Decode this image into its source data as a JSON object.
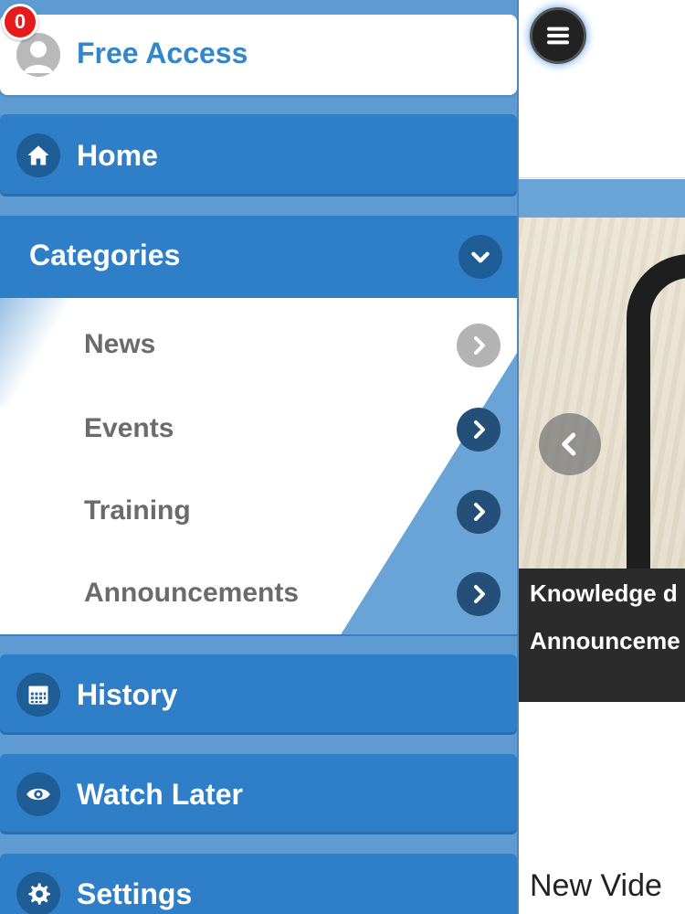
{
  "menu": {
    "user_label": "Free Access",
    "notification_count": "0",
    "home_label": "Home",
    "categories_label": "Categories",
    "categories": [
      {
        "label": "News",
        "icon": "chevron-right-icon"
      },
      {
        "label": "Events",
        "icon": "chevron-right-icon"
      },
      {
        "label": "Training",
        "icon": "chevron-right-icon"
      },
      {
        "label": "Announcements",
        "icon": "chevron-right-icon"
      }
    ],
    "history_label": "History",
    "watch_later_label": "Watch Later",
    "settings_label": "Settings"
  },
  "page": {
    "slide_caption_line1": "Knowledge d",
    "slide_caption_line2": "Announceme",
    "section_title": "New Vide"
  },
  "colors": {
    "menu_item_bg": "#2f7fc8",
    "drawer_bg": "#5f9bd3",
    "badge_red": "#e61a1a",
    "user_label": "#3486c9"
  }
}
